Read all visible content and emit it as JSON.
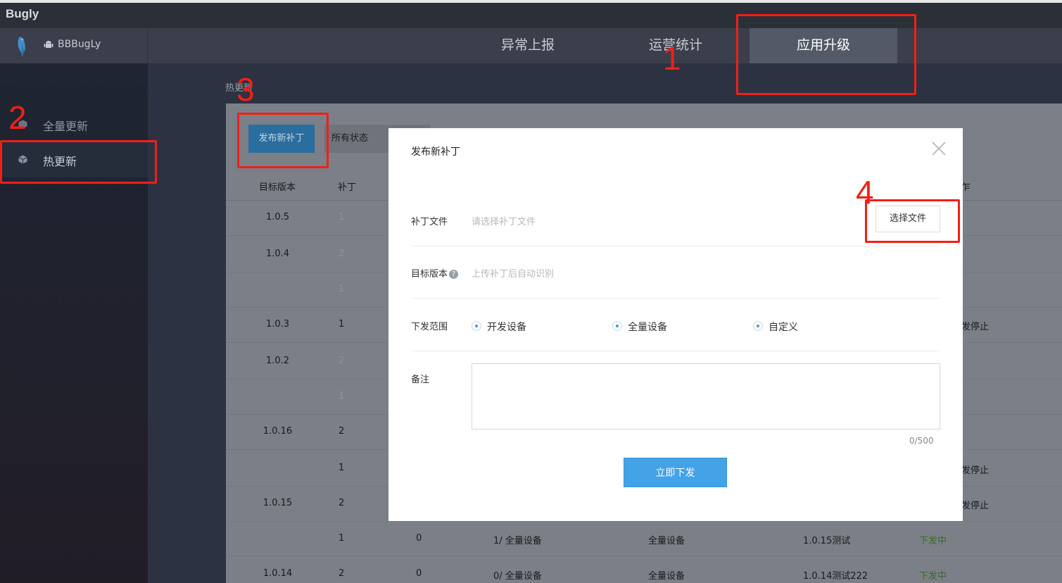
{
  "window": {
    "brand": "Bugly"
  },
  "header": {
    "app_name": "BBBugLy",
    "tabs": [
      {
        "label": "异常上报"
      },
      {
        "label": "运营统计"
      },
      {
        "label": "应用升级"
      }
    ]
  },
  "sidebar": {
    "items": [
      {
        "label": "全量更新"
      },
      {
        "label": "热更新"
      }
    ]
  },
  "main": {
    "breadcrumb": "热更新",
    "publish_button": "发布新补丁",
    "status_filter": "所有状态",
    "columns": [
      "目标版本",
      "补丁"
    ],
    "header_tail": "乍",
    "rows": [
      {
        "version": "1.0.5",
        "patch": "1",
        "patch_dim": true
      },
      {
        "version": "1.0.4",
        "patch": "2",
        "patch_dim": true
      },
      {
        "version": "",
        "patch": "1",
        "patch_dim": true
      },
      {
        "version": "1.0.3",
        "patch": "1",
        "patch_dim": false,
        "tail": "发停止"
      },
      {
        "version": "1.0.2",
        "patch": "2",
        "patch_dim": true
      },
      {
        "version": "",
        "patch": "1",
        "patch_dim": true
      },
      {
        "version": "1.0.16",
        "patch": "2",
        "patch_dim": false
      },
      {
        "version": "",
        "patch": "1",
        "patch_dim": false,
        "tail": "发停止"
      },
      {
        "version": "1.0.15",
        "patch": "2",
        "patch_dim": false,
        "tail": "发停止"
      },
      {
        "version": "",
        "patch": "1",
        "patch_dim": false,
        "count": "0",
        "pushed": "1/ 全量设备",
        "range": "全量设备",
        "note": "1.0.15测试",
        "state": "下发中"
      },
      {
        "version": "1.0.14",
        "patch": "2",
        "patch_dim": false,
        "count": "0",
        "pushed": "0/ 全量设备",
        "range": "全量设备",
        "note": "1.0.14测试222",
        "state": "下发中"
      }
    ]
  },
  "modal": {
    "title": "发布新补丁",
    "patch_file_label": "补丁文件",
    "patch_file_placeholder": "请选择补丁文件",
    "choose_file_button": "选择文件",
    "target_version_label": "目标版本",
    "target_version_hint": "上传补丁后自动识别",
    "scope_label": "下发范围",
    "scope_options": [
      "开发设备",
      "全量设备",
      "自定义"
    ],
    "note_label": "备注",
    "note_value": "",
    "note_counter": "0/500",
    "submit_button": "立即下发"
  },
  "annotations": [
    "1",
    "2",
    "3",
    "4"
  ],
  "colors": {
    "annotation": "#f21f16",
    "primary_button": "#44a2e6",
    "active_tab": "#535966"
  }
}
